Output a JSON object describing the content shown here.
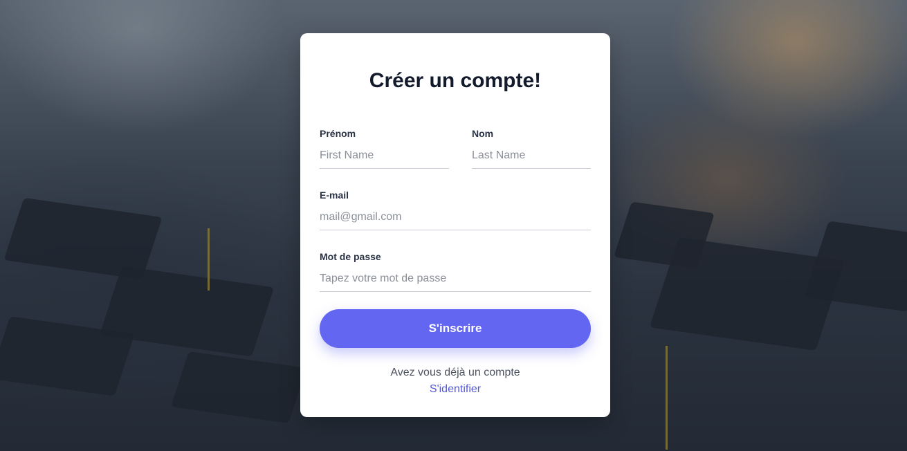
{
  "form": {
    "title": "Créer un compte!",
    "first_name": {
      "label": "Prénom",
      "placeholder": "First Name",
      "value": ""
    },
    "last_name": {
      "label": "Nom",
      "placeholder": "Last Name",
      "value": ""
    },
    "email": {
      "label": "E-mail",
      "placeholder": "mail@gmail.com",
      "value": ""
    },
    "password": {
      "label": "Mot de passe",
      "placeholder": "Tapez votre mot de passe",
      "value": ""
    },
    "submit_label": "S'inscrire",
    "footer_text": "Avez vous déjà un compte",
    "login_link": "S'identifier"
  },
  "colors": {
    "accent": "#6366f1",
    "link": "#5458d6",
    "title": "#121a2b"
  }
}
